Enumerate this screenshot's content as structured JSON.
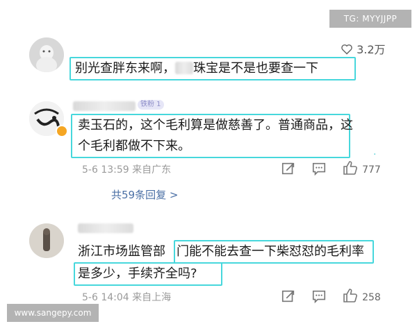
{
  "watermark": {
    "top": "TG: MYYJJPP",
    "bottom": "www.sangepy.com"
  },
  "comment1": {
    "likes": "3.2万",
    "text_part1": "别光查胖东来啊，",
    "text_part2": "珠宝是不是也要查一下"
  },
  "comment2": {
    "fan_badge": "铁粉 1",
    "line1": "卖玉石的，这个毛利算是做慈善了。普通商品，这",
    "line2": "个毛利都做不下来。",
    "timestamp": "5-6 13:59",
    "location": "来自广东",
    "likes": "777",
    "replies_link": "共59条回复 >"
  },
  "comment3": {
    "line1_a": "浙江市场监管部",
    "line1_b": "门能不能去查一下柴怼怼的毛利率",
    "line2": "是多少，手续齐全吗?",
    "timestamp": "5-6 14:04",
    "location": "来自上海",
    "likes": "258"
  },
  "icons": {
    "like": "thumbs-up-icon",
    "heart": "heart-icon",
    "share": "share-icon",
    "comment": "comment-icon"
  }
}
